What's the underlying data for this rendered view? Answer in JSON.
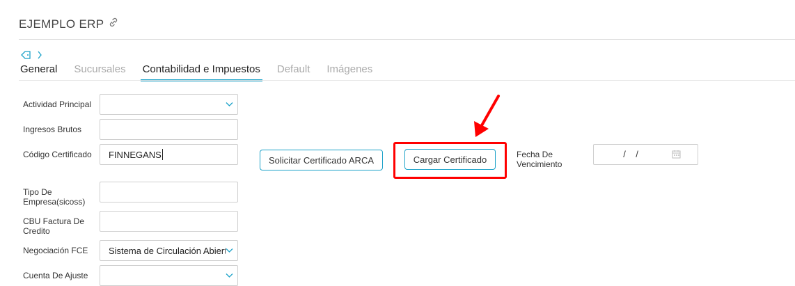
{
  "app": {
    "title": "EJEMPLO ERP",
    "link_icon": "link-icon"
  },
  "breadcrumb": {
    "tag_icon": "tag-icon",
    "chevron_icon": "chevron-right-icon"
  },
  "tabs": [
    {
      "label": "General",
      "active": false
    },
    {
      "label": "Sucursales",
      "active": false
    },
    {
      "label": "Contabilidad e Impuestos",
      "active": true
    },
    {
      "label": "Default",
      "active": false
    },
    {
      "label": "Imágenes",
      "active": false
    }
  ],
  "form": {
    "actividad_principal": {
      "label": "Actividad Principal",
      "value": ""
    },
    "ingresos_brutos": {
      "label": "Ingresos Brutos",
      "value": ""
    },
    "codigo_certificado": {
      "label": "Código Certificado",
      "value": "FINNEGANS"
    },
    "tipo_empresa": {
      "label": "Tipo De Empresa(sicoss)",
      "value": ""
    },
    "cbu_factura": {
      "label": "CBU Factura De Credito",
      "value": ""
    },
    "negociacion_fce": {
      "label": "Negociación FCE",
      "value": "Sistema de Circulación Abierta"
    },
    "cuenta_ajuste": {
      "label": "Cuenta De Ajuste",
      "value": ""
    },
    "fecha_vencimiento": {
      "label": "Fecha De Vencimiento",
      "value": "  /    /"
    }
  },
  "buttons": {
    "solicitar": "Solicitar Certificado ARCA",
    "cargar": "Cargar Certificado"
  },
  "annotation": {
    "color": "#ff0000",
    "target": "cargar-certificado-button"
  },
  "accent_color": "#1aa1c8"
}
